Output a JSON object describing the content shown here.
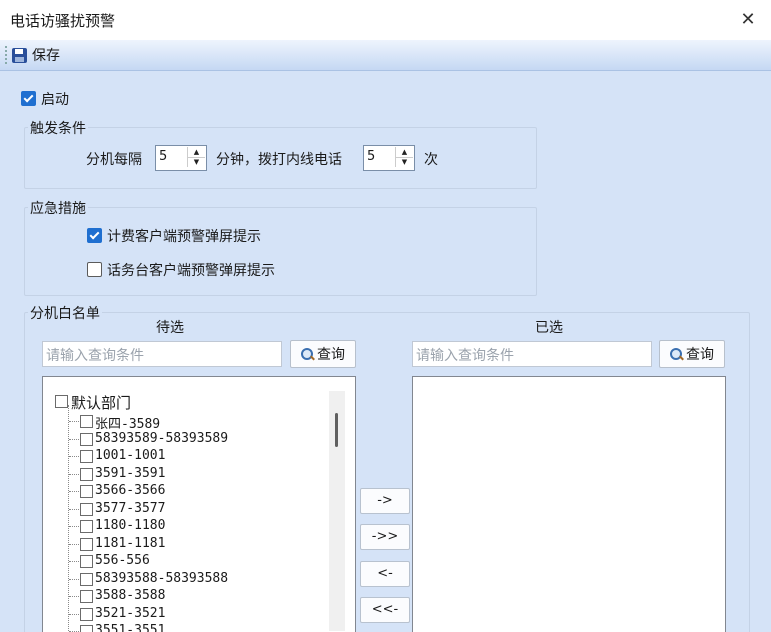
{
  "window": {
    "title": "电话访骚扰预警"
  },
  "toolbar": {
    "save_label": "保存"
  },
  "enable": {
    "label": "启动",
    "checked": true
  },
  "trigger": {
    "legend": "触发条件",
    "prefix": "分机每隔",
    "minutes_value": "5",
    "middle": "分钟，拨打内线电话",
    "calls_value": "5",
    "suffix": "次"
  },
  "emergency": {
    "legend": "应急措施",
    "option1": {
      "label": "计费客户端预警弹屏提示",
      "checked": true
    },
    "option2": {
      "label": "话务台客户端预警弹屏提示",
      "checked": false
    }
  },
  "whitelist": {
    "legend": "分机白名单",
    "pending_header": "待选",
    "selected_header": "已选",
    "search_placeholder": "请输入查询条件",
    "query_label": "查询",
    "tree": {
      "root": "默认部门",
      "items": [
        "张四-3589",
        "58393589-58393589",
        "1001-1001",
        "3591-3591",
        "3566-3566",
        "3577-3577",
        "1180-1180",
        "1181-1181",
        "556-556",
        "58393588-58393588",
        "3588-3588",
        "3521-3521",
        "3551-3551"
      ]
    },
    "move_buttons": [
      "->",
      "->>",
      "<-",
      "<<-"
    ]
  },
  "colors": {
    "accent": "#1f6fd0",
    "background": "#d5e3f7"
  }
}
